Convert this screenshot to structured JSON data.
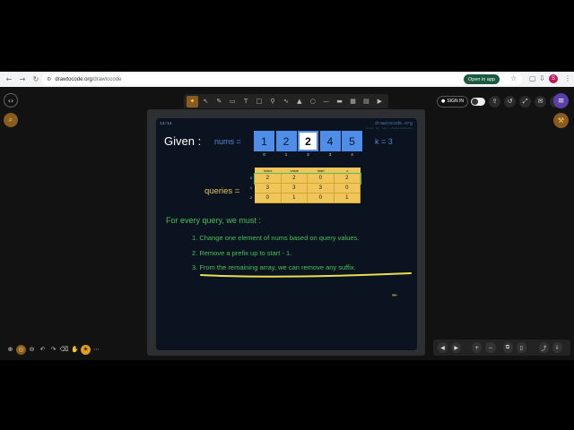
{
  "browser": {
    "url_host": "drawtocode.org",
    "url_path": "/drawtocode",
    "open_in_app": "Open in app",
    "avatar_letter": "S"
  },
  "toolbar": {
    "signin": "SIGN IN"
  },
  "slide": {
    "page": "13/14",
    "brand": "drawtocode.org",
    "brand_sub": "visit for more visualizations",
    "given": "Given :",
    "nums_label": "nums =",
    "nums": [
      "1",
      "2",
      "2",
      "4",
      "5"
    ],
    "indices": [
      "0",
      "1",
      "2",
      "3",
      "4"
    ],
    "k_label": "k = 3",
    "queries_label": "queries =",
    "queries_header": [
      "index",
      "value",
      "start",
      "x"
    ],
    "queries_rows": [
      {
        "i": "0",
        "cells": [
          "2",
          "2",
          "0",
          "2"
        ]
      },
      {
        "i": "1",
        "cells": [
          "3",
          "3",
          "3",
          "0"
        ]
      },
      {
        "i": "2",
        "cells": [
          "0",
          "1",
          "0",
          "1"
        ]
      }
    ],
    "rule_title": "For every query, we must :",
    "rule1": "1. Change one element of nums based on query values.",
    "rule2": "2. Remove a prefix up to start - 1.",
    "rule3": "3. From the remaining array, we can remove any suffix."
  },
  "colors": {
    "accent_blue": "#4e8ee8",
    "table_yellow": "#f0c65a",
    "text_green": "#46c05a",
    "highlight_yellow": "#e8e050"
  }
}
